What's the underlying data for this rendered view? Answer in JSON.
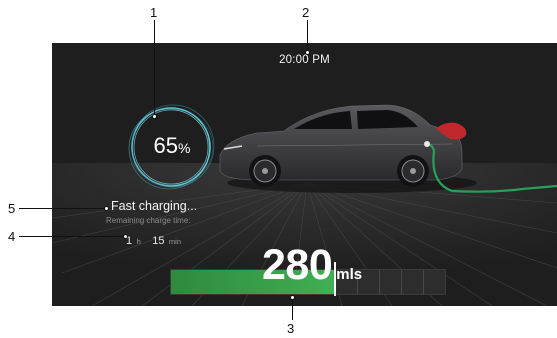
{
  "dashboard": {
    "time": "20:00 PM",
    "battery": {
      "percent_value": "65",
      "percent_unit": "%",
      "level": 65
    },
    "status": "Fast charging...",
    "remaining_label": "Remaining charge time:",
    "remaining": {
      "hours": "1",
      "hours_unit": "h",
      "minutes": "15",
      "minutes_unit": "min"
    },
    "range": {
      "value": "280",
      "unit": "mls"
    },
    "range_bar_segments": 5
  },
  "callouts": [
    "1",
    "2",
    "3",
    "4",
    "5"
  ],
  "colors": {
    "screen_bg": "#1e1e1e",
    "ring": "#7fd1dc",
    "bar_fill": "#3aa44c",
    "cable": "#27a05a",
    "plug": "#c0282c"
  }
}
